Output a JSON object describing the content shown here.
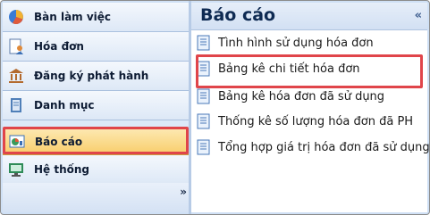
{
  "sidebar": {
    "items": [
      {
        "label": "Bàn làm việc",
        "icon": "pie-chart-icon"
      },
      {
        "label": "Hóa đơn",
        "icon": "user-document-icon"
      },
      {
        "label": "Đăng ký phát hành",
        "icon": "bank-building-icon"
      },
      {
        "label": "Danh mục",
        "icon": "catalog-book-icon"
      },
      {
        "label": "Báo cáo",
        "icon": "report-chart-icon",
        "active": true
      },
      {
        "label": "Hệ thống",
        "icon": "system-monitor-icon"
      }
    ],
    "more_glyph": "»"
  },
  "panel": {
    "title": "Báo cáo",
    "collapse_glyph": "«",
    "links": [
      {
        "label": "Tình hình sử dụng hóa đơn"
      },
      {
        "label": "Bảng kê chi tiết hóa đơn",
        "highlighted": true
      },
      {
        "label": "Bảng kê hóa đơn đã sử dụng"
      },
      {
        "label": "Thống kê số lượng hóa đơn đã PH"
      },
      {
        "label": "Tổng hợp giá trị hóa đơn đã sử dụng"
      }
    ]
  },
  "colors": {
    "highlight_border": "#e0454a",
    "active_nav": "#f8cd6a"
  }
}
